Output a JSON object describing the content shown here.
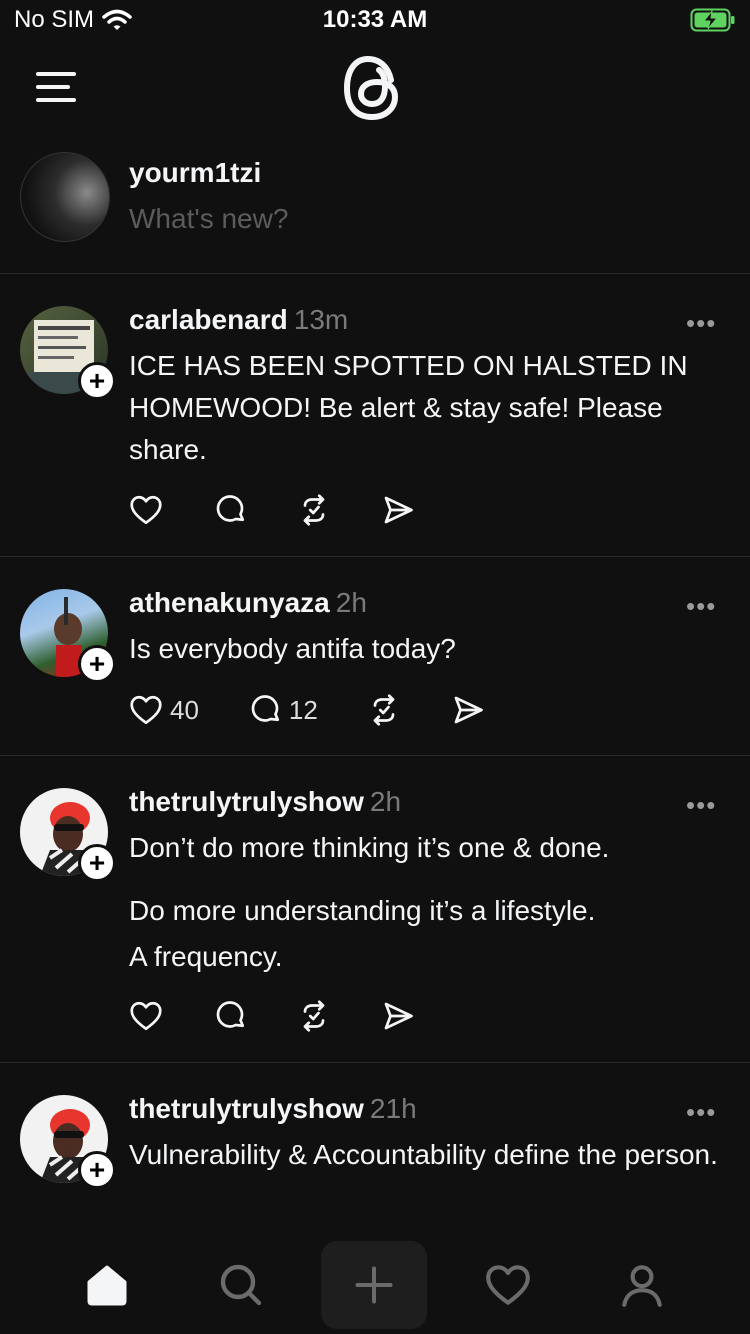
{
  "status_bar": {
    "carrier": "No SIM",
    "time": "10:33 AM"
  },
  "composer": {
    "username": "yourm1tzi",
    "placeholder": "What's new?"
  },
  "posts": [
    {
      "username": "carlabenard",
      "time": "13m",
      "lines": [
        "ICE HAS BEEN SPOTTED ON HALSTED IN HOMEWOOD!  Be alert & stay safe! Please share."
      ],
      "likes": "",
      "replies": ""
    },
    {
      "username": "athenakunyaza",
      "time": "2h",
      "lines": [
        "Is everybody antifa today?"
      ],
      "likes": "40",
      "replies": "12"
    },
    {
      "username": "thetrulytrulyshow",
      "time": "2h",
      "lines": [
        "Don’t do more thinking it’s one & done.",
        "Do more understanding it’s a lifestyle.\nA frequency."
      ],
      "likes": "",
      "replies": ""
    },
    {
      "username": "thetrulytrulyshow",
      "time": "21h",
      "lines": [
        "Vulnerability & Accountability define the person."
      ],
      "likes": "",
      "replies": ""
    }
  ],
  "more_glyph": "•••",
  "follow_glyph": "+",
  "icons": [
    "menu-icon",
    "threads-logo-icon",
    "heart-icon",
    "reply-icon",
    "repost-icon",
    "share-icon",
    "home-icon",
    "search-icon",
    "create-icon",
    "activity-icon",
    "profile-icon"
  ]
}
